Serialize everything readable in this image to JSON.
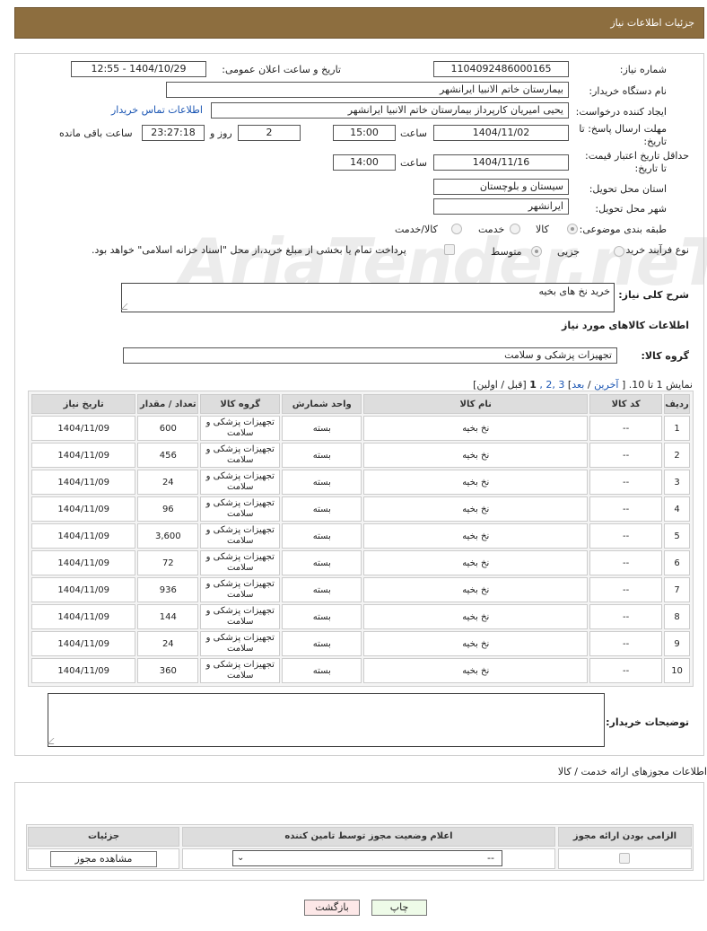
{
  "header": {
    "title": "جزئیات اطلاعات نیاز"
  },
  "form": {
    "need_number_label": "شماره نیاز:",
    "need_number": "1104092486000165",
    "announce_label": "تاریخ و ساعت اعلان عمومی:",
    "announce_value": "1404/10/29 - 12:55",
    "buyer_label": "نام دستگاه خریدار:",
    "buyer_value": "بیمارستان خاتم الانبیا ایرانشهر",
    "creator_label": "ایجاد کننده درخواست:",
    "creator_value": "یحیی امیریان کارپرداز بیمارستان خاتم الانبیا ایرانشهر",
    "contact_link": "اطلاعات تماس خریدار",
    "deadline_label_1": "مهلت ارسال پاسخ: تا",
    "deadline_label_2": "تاریخ:",
    "deadline_date": "1404/11/02",
    "time_label": "ساعت",
    "deadline_time": "15:00",
    "days_value": "2",
    "days_label": "روز و",
    "remaining_value": "23:27:18",
    "remaining_label": "ساعت باقی مانده",
    "price_label_1": "حداقل تاریخ اعتبار قیمت:",
    "price_label_2": "تا تاریخ:",
    "price_date": "1404/11/16",
    "price_time_label": "ساعت",
    "price_time": "14:00",
    "province_label": "استان محل تحویل:",
    "province_value": "سیستان و بلوچستان",
    "city_label": "شهر محل تحویل:",
    "city_value": "ایرانشهر",
    "category_label": "طبقه بندی موضوعی:",
    "cat_goods": "کالا",
    "cat_service": "خدمت",
    "cat_both": "کالا/خدمت",
    "process_label": "نوع فرآیند خرید :",
    "proc_partial": "جزیی",
    "proc_medium": "متوسط",
    "treasury_note": "پرداخت تمام یا بخشی از مبلغ خرید،از محل \"اسناد خزانه اسلامی\" خواهد بود.",
    "desc_label": "شرح کلی نیاز:",
    "desc_value": "خرید نخ های بخیه",
    "goods_info_title": "اطلاعات کالاهای مورد نیاز",
    "group_label": "گروه کالا:",
    "group_value": "تجهیزات پزشکی و سلامت",
    "paging": {
      "prefix": "نمایش 1 تا 10. [",
      "last": "آخرین",
      "sep1": "/",
      "next": "بعد",
      "pages_links": "3 ,2 ,",
      "current": "1",
      "suffix": "[قبل / اولین]"
    },
    "buyer_notes_label": "توضیحات خریدار:"
  },
  "table": {
    "headers": [
      "ردیف",
      "کد کالا",
      "نام کالا",
      "واحد شمارش",
      "گروه کالا",
      "تعداد / مقدار",
      "تاریخ نیاز"
    ],
    "rows": [
      [
        "1",
        "--",
        "نخ بخیه",
        "بسته",
        "تجهیزات پزشکی و سلامت",
        "600",
        "1404/11/09"
      ],
      [
        "2",
        "--",
        "نخ بخیه",
        "بسته",
        "تجهیزات پزشکی و سلامت",
        "456",
        "1404/11/09"
      ],
      [
        "3",
        "--",
        "نخ بخیه",
        "بسته",
        "تجهیزات پزشکی و سلامت",
        "24",
        "1404/11/09"
      ],
      [
        "4",
        "--",
        "نخ بخیه",
        "بسته",
        "تجهیزات پزشکی و سلامت",
        "96",
        "1404/11/09"
      ],
      [
        "5",
        "--",
        "نخ بخیه",
        "بسته",
        "تجهیزات پزشکی و سلامت",
        "3,600",
        "1404/11/09"
      ],
      [
        "6",
        "--",
        "نخ بخیه",
        "بسته",
        "تجهیزات پزشکی و سلامت",
        "72",
        "1404/11/09"
      ],
      [
        "7",
        "--",
        "نخ بخیه",
        "بسته",
        "تجهیزات پزشکی و سلامت",
        "936",
        "1404/11/09"
      ],
      [
        "8",
        "--",
        "نخ بخیه",
        "بسته",
        "تجهیزات پزشکی و سلامت",
        "144",
        "1404/11/09"
      ],
      [
        "9",
        "--",
        "نخ بخیه",
        "بسته",
        "تجهیزات پزشکی و سلامت",
        "24",
        "1404/11/09"
      ],
      [
        "10",
        "--",
        "نخ بخیه",
        "بسته",
        "تجهیزات پزشکی و سلامت",
        "360",
        "1404/11/09"
      ]
    ]
  },
  "permits": {
    "title": "اطلاعات مجوزهای ارائه خدمت / کالا",
    "headers": [
      "الزامی بودن ارائه مجوز",
      "اعلام وضعیت مجوز توسط تامین کننده",
      "جزئیات"
    ],
    "select_value": "--",
    "view_button": "مشاهده مجوز"
  },
  "buttons": {
    "print": "چاپ",
    "back": "بازگشت"
  },
  "watermark": "AriaTender.neT"
}
